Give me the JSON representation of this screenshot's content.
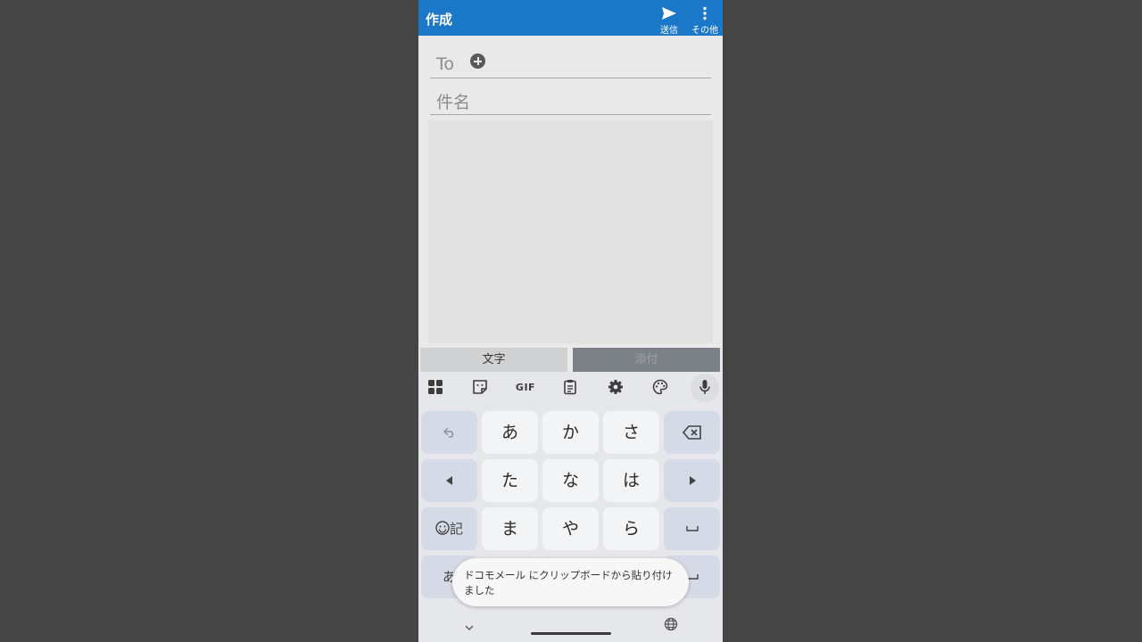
{
  "appbar": {
    "title": "作成",
    "send_label": "送信",
    "more_label": "その他",
    "color": "#1b77c8"
  },
  "compose": {
    "to_label": "To",
    "subject_label": "件名"
  },
  "tabs": {
    "text_tab": "文字",
    "attach_tab": "添付"
  },
  "keyboard": {
    "toolbar": {
      "gif_label": "GIF",
      "icons": [
        "apps-icon",
        "sticker-icon",
        "gif-icon",
        "clipboard-icon",
        "settings-icon",
        "palette-icon",
        "mic-icon"
      ]
    },
    "rows": [
      [
        "あ",
        "か",
        "さ"
      ],
      [
        "た",
        "な",
        "は"
      ],
      [
        "ま",
        "や",
        "ら"
      ]
    ],
    "mode_label": "あ",
    "emoji_symbol_label": "記"
  },
  "toast": {
    "line1": "ドコモメール にクリップボードから貼り付け",
    "line2": "ました"
  }
}
